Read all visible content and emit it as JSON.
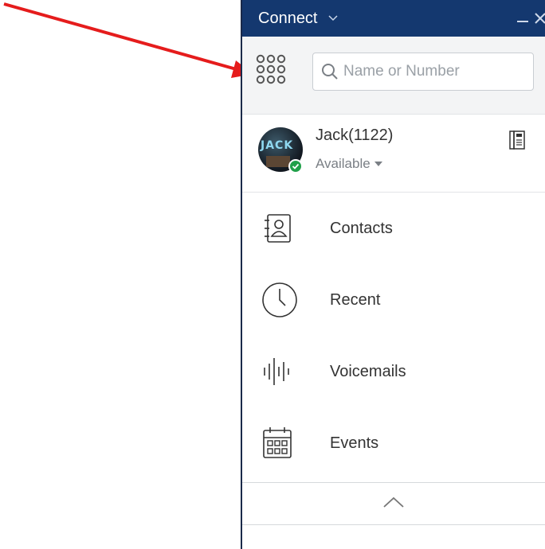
{
  "header": {
    "app_title": "Connect"
  },
  "search": {
    "placeholder": "Name or Number",
    "value": ""
  },
  "profile": {
    "name": "Jack(1122)",
    "status": "Available",
    "avatar_text": "JACK"
  },
  "nav": {
    "items": [
      {
        "label": "Contacts",
        "icon": "contacts-icon"
      },
      {
        "label": "Recent",
        "icon": "clock-icon"
      },
      {
        "label": "Voicemails",
        "icon": "voicemail-waveform-icon"
      },
      {
        "label": "Events",
        "icon": "calendar-icon"
      }
    ]
  },
  "colors": {
    "titlebar": "#14386f",
    "presence_available": "#21a04a",
    "annotation_arrow": "#e51c1c"
  }
}
